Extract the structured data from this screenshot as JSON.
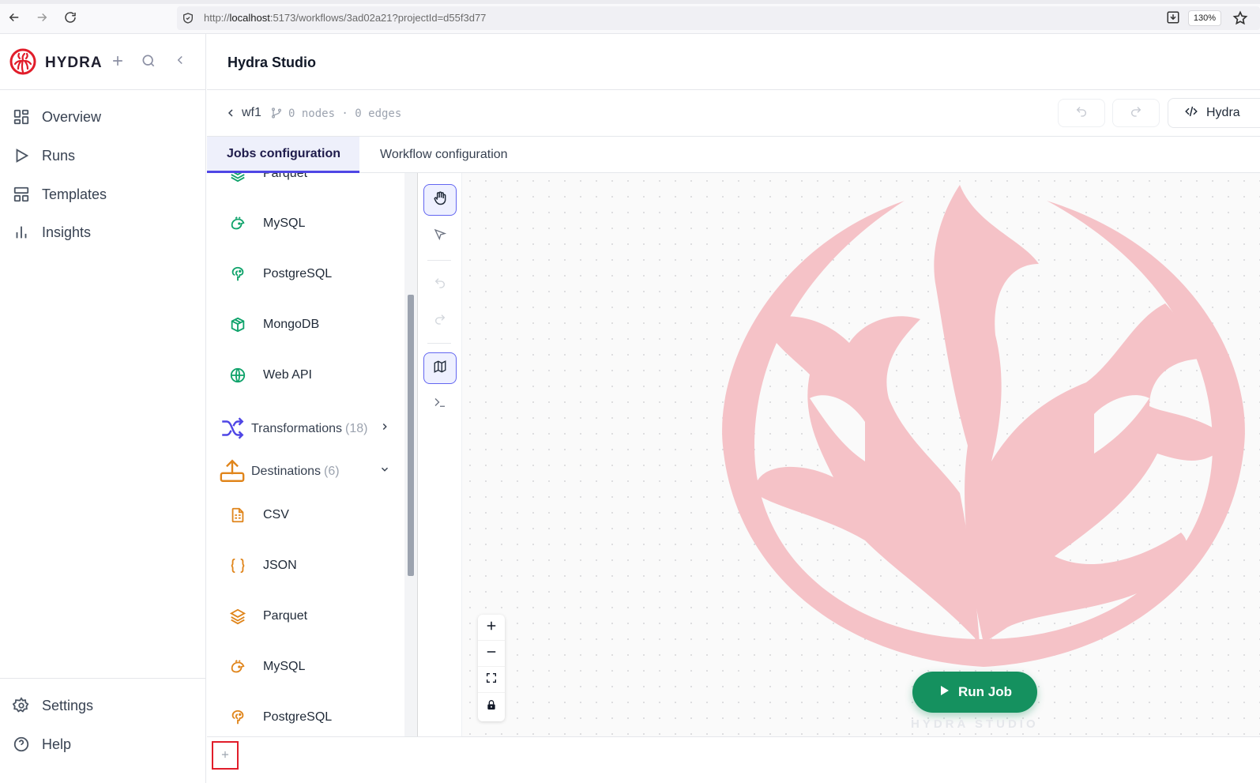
{
  "browser": {
    "url_prefix": "http://",
    "url_host": "localhost",
    "url_rest": ":5173/workflows/3ad02a21?projectId=d55f3d77",
    "zoom": "130%"
  },
  "sidebar": {
    "brand": "HYDRA",
    "items": [
      {
        "label": "Overview",
        "icon": "grid-icon"
      },
      {
        "label": "Runs",
        "icon": "play-outline-icon"
      },
      {
        "label": "Templates",
        "icon": "layout-icon"
      },
      {
        "label": "Insights",
        "icon": "bar-chart-icon"
      }
    ],
    "bottom_items": [
      {
        "label": "Settings",
        "icon": "gear-icon"
      },
      {
        "label": "Help",
        "icon": "help-circle-icon"
      }
    ]
  },
  "header": {
    "title": "Hydra Studio"
  },
  "workflow": {
    "name": "wf1",
    "stats": "0 nodes · 0 edges",
    "code_button_label": "Hydra"
  },
  "tabs": [
    {
      "label": "Jobs configuration",
      "active": true
    },
    {
      "label": "Workflow configuration",
      "active": false
    }
  ],
  "palette": {
    "sources_tail": [
      {
        "label": "Parquet",
        "icon": "layers-icon"
      },
      {
        "label": "MySQL",
        "icon": "dolphin-icon"
      },
      {
        "label": "PostgreSQL",
        "icon": "elephant-icon"
      },
      {
        "label": "MongoDB",
        "icon": "package-icon"
      },
      {
        "label": "Web API",
        "icon": "globe-icon"
      }
    ],
    "transformations": {
      "label": "Transformations",
      "count": "(18)",
      "expanded": false
    },
    "destinations": {
      "label": "Destinations",
      "count": "(6)",
      "expanded": true
    },
    "destination_items": [
      {
        "label": "CSV",
        "icon": "file-spreadsheet-icon"
      },
      {
        "label": "JSON",
        "icon": "braces-icon"
      },
      {
        "label": "Parquet",
        "icon": "layers-icon"
      },
      {
        "label": "MySQL",
        "icon": "dolphin-icon"
      },
      {
        "label": "PostgreSQL",
        "icon": "elephant-icon"
      }
    ]
  },
  "canvas": {
    "run_button_label": "Run Job",
    "watermark_text": "HYDRA STUDIO"
  },
  "colors": {
    "accent": "#4f46e5",
    "source_icon": "#10a36b",
    "destination_icon": "#e0851b",
    "run_button": "#15915f",
    "watermark": "#f5c2c7"
  }
}
